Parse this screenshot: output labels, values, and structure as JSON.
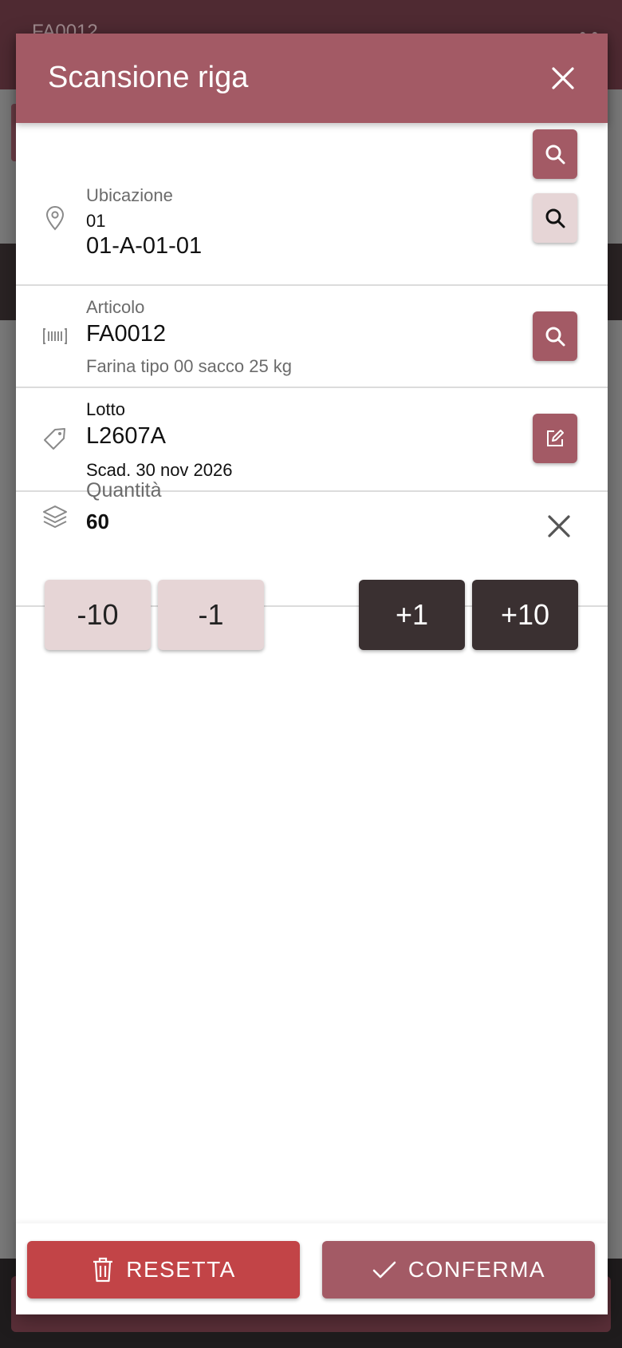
{
  "background": {
    "header_text": "FA0012",
    "header_right": "• •"
  },
  "modal": {
    "title": "Scansione riga",
    "location": {
      "label": "Ubicazione",
      "code": "01",
      "value": "01-A-01-01"
    },
    "article": {
      "label": "Articolo",
      "code": "FA0012",
      "description": "Farina tipo 00 sacco 25 kg"
    },
    "lot": {
      "label": "Lotto",
      "code": "L2607A",
      "expiry": "Scad. 30 nov 2026"
    },
    "quantity": {
      "label": "Quantità",
      "value": "60"
    },
    "steppers": {
      "minus10": "-10",
      "minus1": "-1",
      "plus1": "+1",
      "plus10": "+10"
    },
    "footer": {
      "reset_label": "RESETTA",
      "confirm_label": "CONFERMA"
    }
  },
  "colors": {
    "accent": "#a35a65",
    "danger": "#c24447",
    "dark": "#3a3031",
    "light_btn": "#e6d5d6"
  }
}
